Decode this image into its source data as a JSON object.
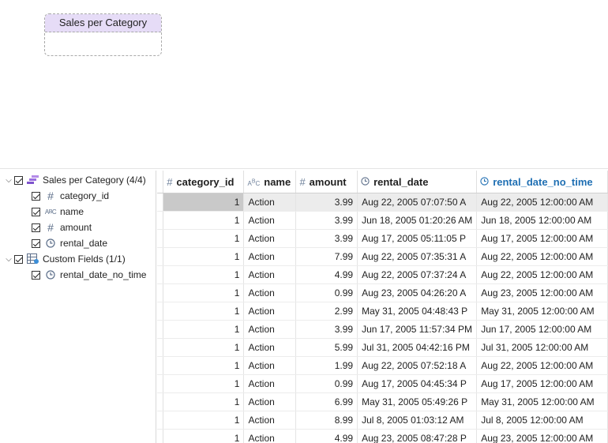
{
  "canvas": {
    "entity_title": "Sales per Category"
  },
  "tree": {
    "root": {
      "label": "Sales per Category (4/4)",
      "icon": "table-stack-icon"
    },
    "fields": [
      {
        "label": "category_id",
        "icon": "hash-icon"
      },
      {
        "label": "name",
        "icon": "abc-icon"
      },
      {
        "label": "amount",
        "icon": "hash-icon"
      },
      {
        "label": "rental_date",
        "icon": "clock-icon"
      }
    ],
    "custom_root": {
      "label": "Custom Fields (1/1)",
      "icon": "custom-table-icon"
    },
    "custom_fields": [
      {
        "label": "rental_date_no_time",
        "icon": "clock-icon"
      }
    ]
  },
  "grid": {
    "columns": [
      {
        "label": "category_id",
        "icon": "hash-icon"
      },
      {
        "label": "name",
        "icon": "abc-icon"
      },
      {
        "label": "amount",
        "icon": "hash-icon"
      },
      {
        "label": "rental_date",
        "icon": "clock-icon"
      },
      {
        "label": "rental_date_no_time",
        "icon": "clock-icon",
        "accent": "#1f6fb3"
      }
    ],
    "rows": [
      [
        "1",
        "Action",
        "3.99",
        "Aug 22, 2005 07:07:50 A",
        "Aug 22, 2005 12:00:00 AM"
      ],
      [
        "1",
        "Action",
        "3.99",
        "Jun 18, 2005 01:20:26 AM",
        "Jun 18, 2005 12:00:00 AM"
      ],
      [
        "1",
        "Action",
        "3.99",
        "Aug 17, 2005 05:11:05 P",
        "Aug 17, 2005 12:00:00 AM"
      ],
      [
        "1",
        "Action",
        "7.99",
        "Aug 22, 2005 07:35:31 A",
        "Aug 22, 2005 12:00:00 AM"
      ],
      [
        "1",
        "Action",
        "4.99",
        "Aug 22, 2005 07:37:24 A",
        "Aug 22, 2005 12:00:00 AM"
      ],
      [
        "1",
        "Action",
        "0.99",
        "Aug 23, 2005 04:26:20 A",
        "Aug 23, 2005 12:00:00 AM"
      ],
      [
        "1",
        "Action",
        "2.99",
        "May 31, 2005 04:48:43 P",
        "May 31, 2005 12:00:00 AM"
      ],
      [
        "1",
        "Action",
        "3.99",
        "Jun 17, 2005 11:57:34 PM",
        "Jun 17, 2005 12:00:00 AM"
      ],
      [
        "1",
        "Action",
        "5.99",
        "Jul 31, 2005 04:42:16 PM",
        "Jul 31, 2005 12:00:00 AM"
      ],
      [
        "1",
        "Action",
        "1.99",
        "Aug 22, 2005 07:52:18 A",
        "Aug 22, 2005 12:00:00 AM"
      ],
      [
        "1",
        "Action",
        "0.99",
        "Aug 17, 2005 04:45:34 P",
        "Aug 17, 2005 12:00:00 AM"
      ],
      [
        "1",
        "Action",
        "6.99",
        "May 31, 2005 05:49:26 P",
        "May 31, 2005 12:00:00 AM"
      ],
      [
        "1",
        "Action",
        "8.99",
        "Jul 8, 2005 01:03:12 AM",
        "Jul 8, 2005 12:00:00 AM"
      ],
      [
        "1",
        "Action",
        "4.99",
        "Aug 23, 2005 08:47:28 P",
        "Aug 23, 2005 12:00:00 AM"
      ]
    ]
  }
}
